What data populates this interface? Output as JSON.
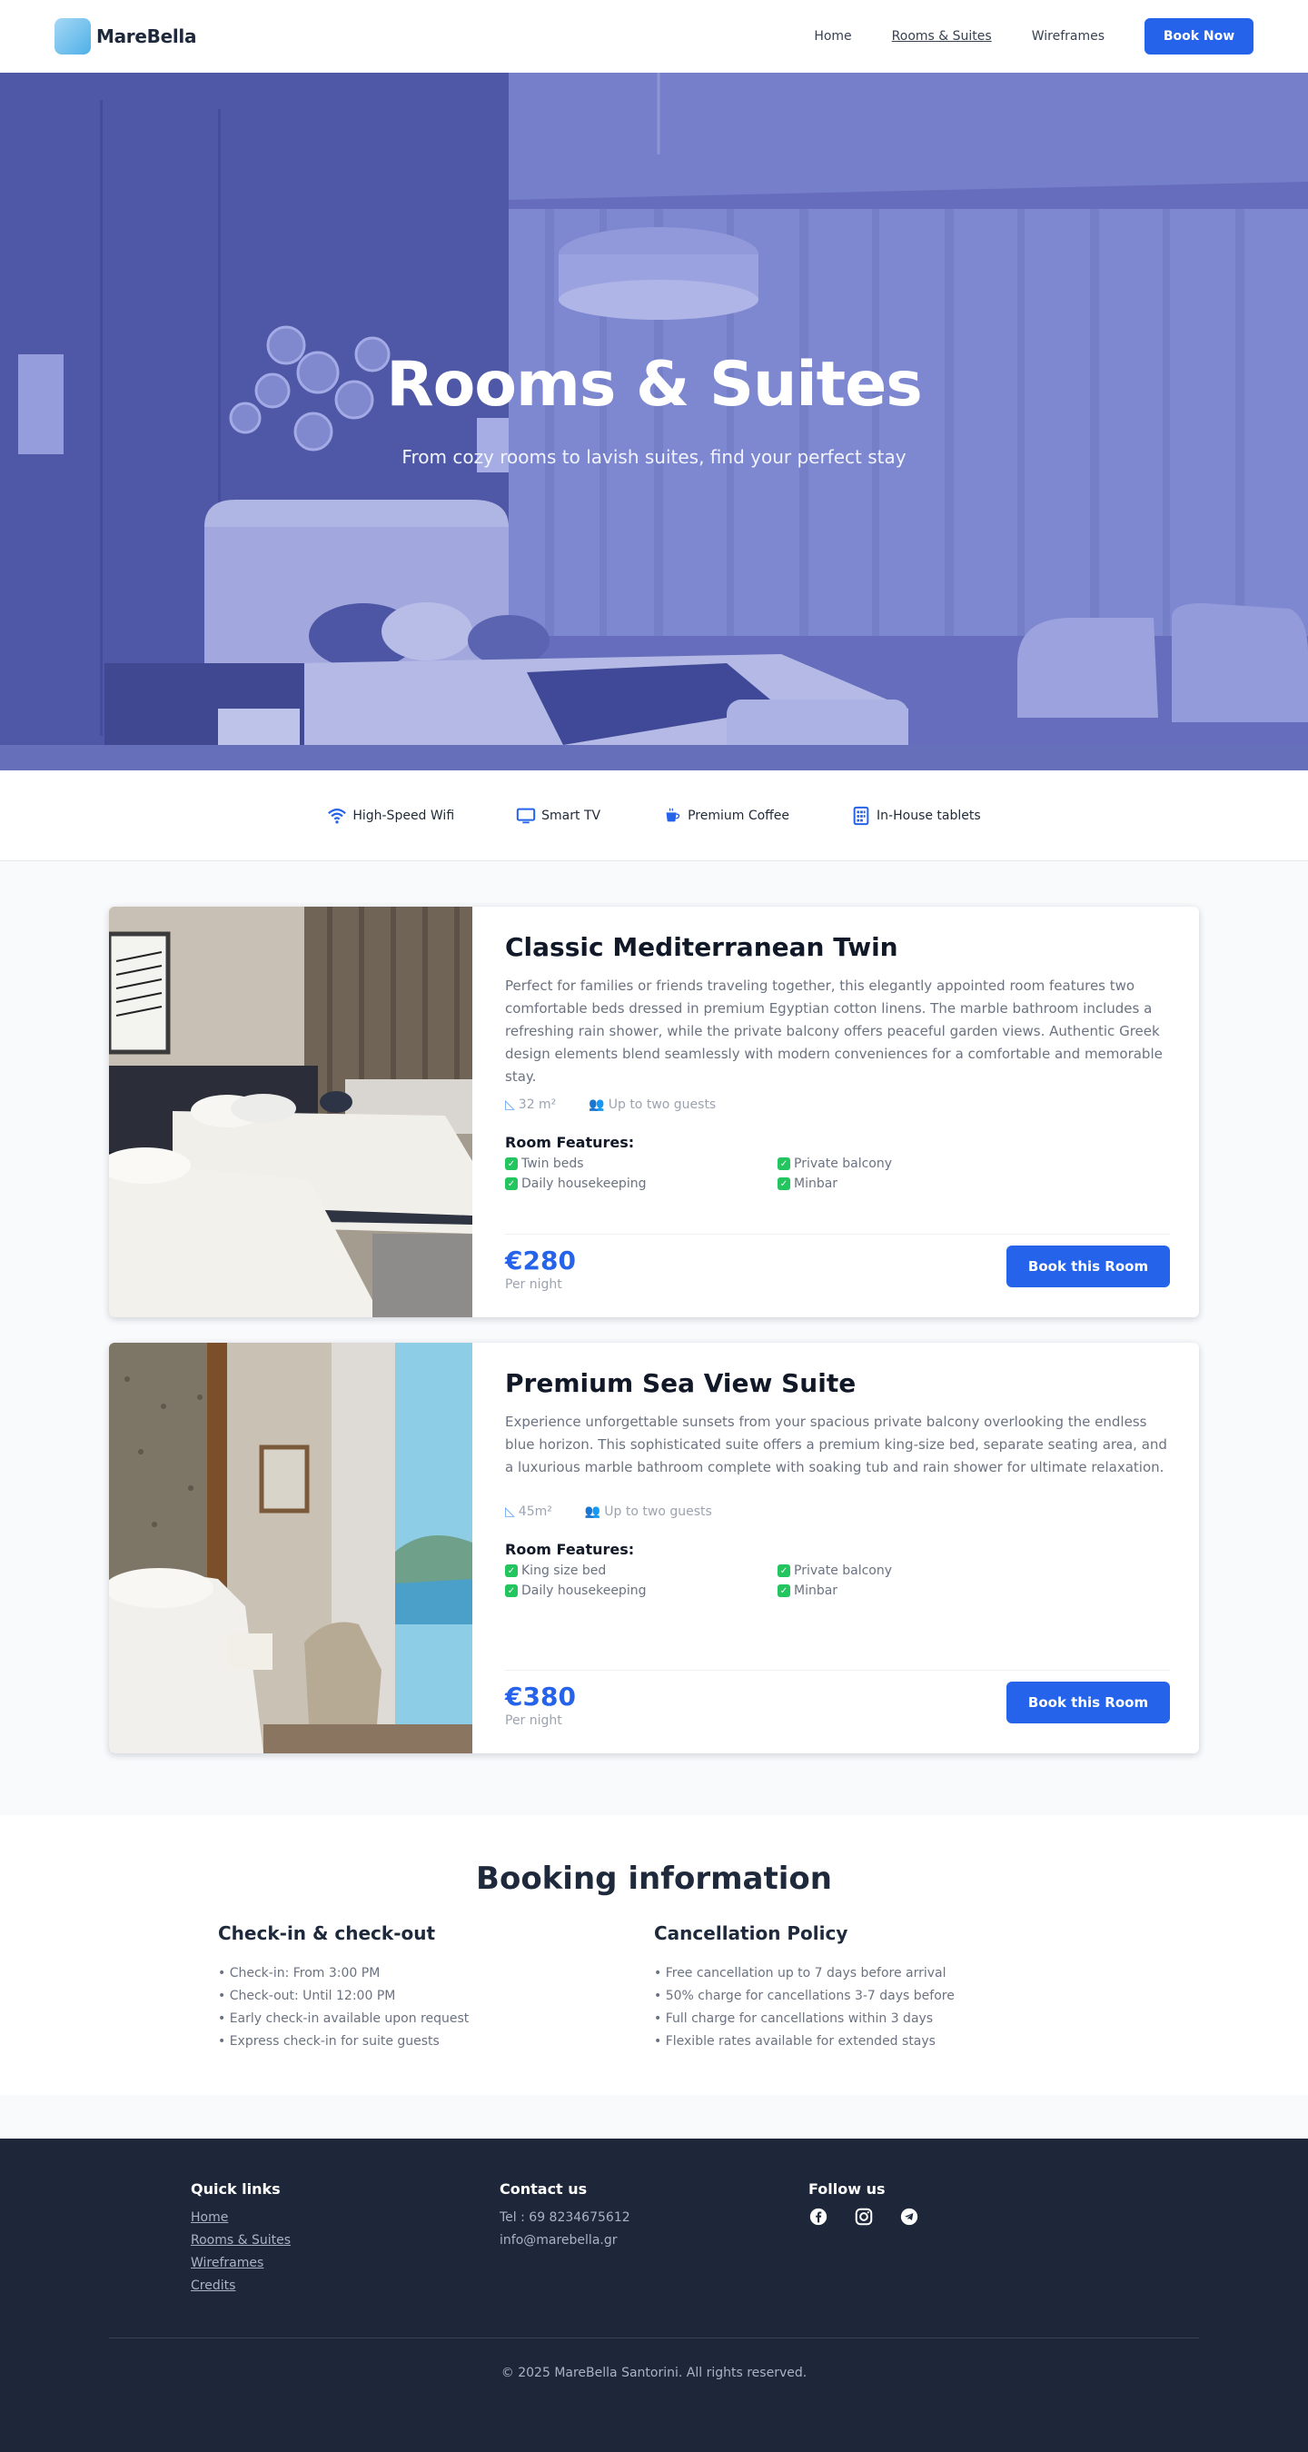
{
  "brand": {
    "name": "MareBella"
  },
  "nav": {
    "items": [
      {
        "label": "Home"
      },
      {
        "label": "Rooms & Suites"
      },
      {
        "label": "Wireframes"
      }
    ],
    "cta": "Book Now"
  },
  "hero": {
    "title": "Rooms & Suites",
    "subtitle": "From cozy rooms to lavish suites, find your perfect stay"
  },
  "amenities": [
    {
      "icon": "wifi-icon",
      "label": "High-Speed Wifi"
    },
    {
      "icon": "tv-icon",
      "label": "Smart TV"
    },
    {
      "icon": "coffee-icon",
      "label": "Premium Coffee"
    },
    {
      "icon": "tablet-icon",
      "label": "In-House tablets"
    }
  ],
  "rooms": [
    {
      "title": "Classic Mediterranean Twin",
      "description": "Perfect for families or friends traveling together, this elegantly appointed room features two comfortable beds dressed in premium Egyptian cotton linens. The marble bathroom includes a refreshing rain shower, while the private balcony offers peaceful garden views. Authentic Greek design elements blend seamlessly with modern conveniences for a comfortable and memorable stay.",
      "size": "32 m²",
      "guests": "Up to two guests",
      "features_title": "Room Features:",
      "features": [
        "Twin beds",
        "Private balcony",
        "Daily housekeeping",
        "Minbar"
      ],
      "price": "€280",
      "per_night": "Per night",
      "cta": "Book this Room"
    },
    {
      "title": "Premium Sea View Suite",
      "description": "Experience unforgettable sunsets from your spacious private balcony overlooking the endless blue horizon. This sophisticated suite offers a premium king-size bed, separate seating area, and a luxurious marble bathroom complete with soaking tub and rain shower for ultimate relaxation.",
      "size": "45m²",
      "guests": "Up to two guests",
      "features_title": "Room Features:",
      "features": [
        "King size bed",
        "Private balcony",
        "Daily housekeeping",
        "Minbar"
      ],
      "price": "€380",
      "per_night": "Per night",
      "cta": "Book this Room"
    }
  ],
  "booking": {
    "title": "Booking information",
    "checkin": {
      "title": "Check-in & check-out",
      "items": [
        "• Check-in: From 3:00 PM",
        "• Check-out: Until 12:00 PM",
        "• Early check-in available upon request",
        "• Express check-in for suite guests"
      ]
    },
    "cancellation": {
      "title": "Cancellation Policy",
      "items": [
        "• Free cancellation up to 7 days before arrival",
        "• 50% charge for cancellations 3-7 days before",
        "• Full charge for cancellations within 3 days",
        "• Flexible rates available for extended stays"
      ]
    }
  },
  "footer": {
    "quick_links": {
      "title": "Quick links",
      "links": [
        "Home",
        "Rooms & Suites",
        "Wireframes",
        "Credits"
      ]
    },
    "contact": {
      "title": "Contact us",
      "phone": "Tel : 69 8234675612",
      "email": "info@marebella.gr"
    },
    "follow": {
      "title": "Follow us",
      "icons": [
        "facebook-icon",
        "instagram-icon",
        "telegram-icon"
      ]
    },
    "copyright": "© 2025 MareBella Santorini. All rights reserved."
  },
  "colors": {
    "accent": "#2563eb",
    "footer_bg": "#1e2739",
    "hero_tint": "#6b74bf"
  }
}
